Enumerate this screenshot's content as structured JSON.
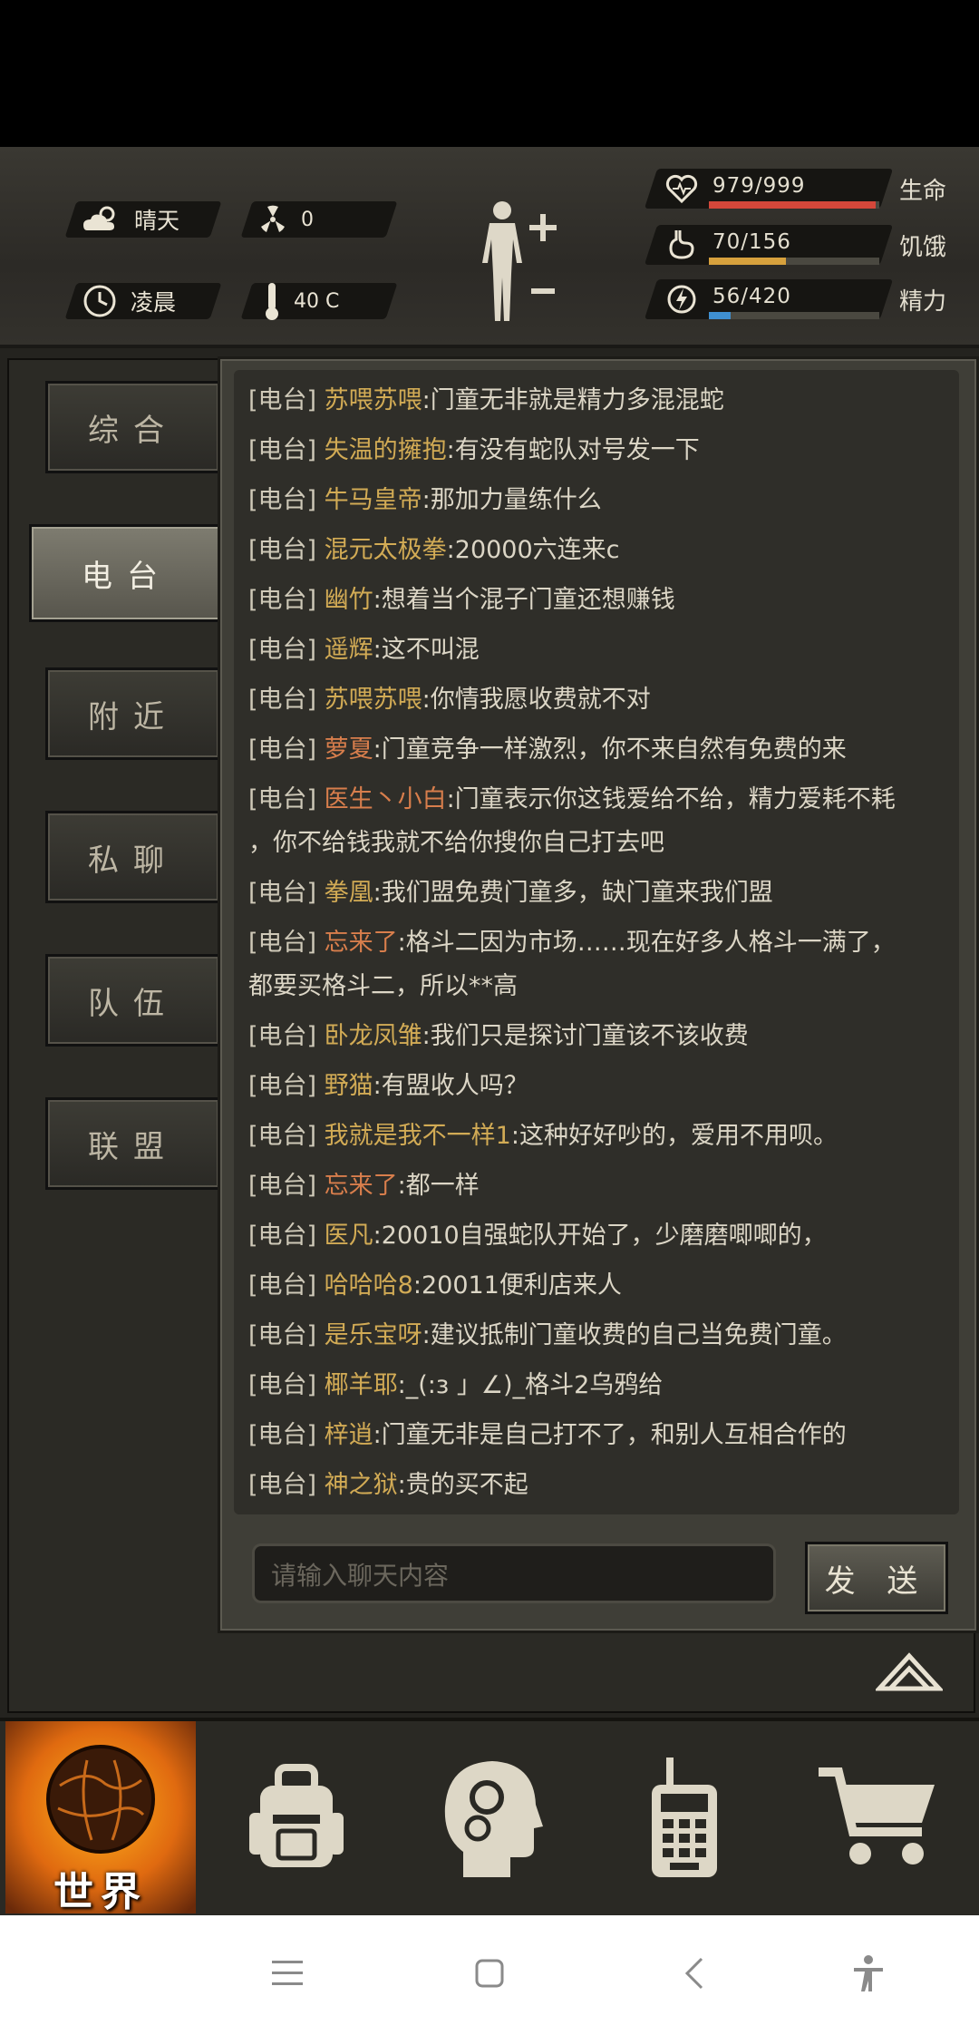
{
  "hud": {
    "weather": "晴天",
    "radiation": "0",
    "time_of_day": "凌晨",
    "temperature": "40 C",
    "stats": [
      {
        "value": "979/999",
        "label": "生命",
        "fraction": 0.98,
        "color": "#d4473a"
      },
      {
        "value": "70/156",
        "label": "饥饿",
        "fraction": 0.45,
        "color": "#d7a13d"
      },
      {
        "value": "56/420",
        "label": "精力",
        "fraction": 0.13,
        "color": "#3f8fd0"
      }
    ]
  },
  "tabs": [
    "综合",
    "电台",
    "附近",
    "私聊",
    "队伍",
    "联盟"
  ],
  "chat": {
    "prefix": "[电台]",
    "messages": [
      {
        "nick": "苏喂苏喂",
        "text": ":门童无非就是精力多混混蛇"
      },
      {
        "nick": "失温的擁抱",
        "text": ":有没有蛇队对号发一下"
      },
      {
        "nick": "牛马皇帝",
        "text": ":那加力量练什么"
      },
      {
        "nick": "混元太极拳",
        "text": ":20000六连来c"
      },
      {
        "nick": "幽竹",
        "text": ":想着当个混子门童还想赚钱"
      },
      {
        "nick": "遥辉",
        "text": ":这不叫混"
      },
      {
        "nick": "苏喂苏喂",
        "text": ":你情我愿收费就不对"
      },
      {
        "nick": "萝夏",
        "text": ":门童竞争一样激烈，你不来自然有免费的来"
      },
      {
        "nick": "医生丶小白",
        "text": ":门童表示你这钱爱给不给，精力爱耗不耗",
        "cont": "，你不给钱我就不给你搜你自己打去吧"
      },
      {
        "nick": "拳凰",
        "text": ":我们盟免费门童多，缺门童来我们盟"
      },
      {
        "nick": "忘来了",
        "text": ":格斗二因为市场……现在好多人格斗一满了，",
        "cont": "都要买格斗二，所以**高"
      },
      {
        "nick": "卧龙凤雏",
        "text": ":我们只是探讨门童该不该收费"
      },
      {
        "nick": "野猫",
        "text": ":有盟收人吗？"
      },
      {
        "nick": "我就是我不一样1",
        "text": ":这种好好吵的，爱用不用呗。"
      },
      {
        "nick": "忘来了",
        "text": ":都一样"
      },
      {
        "nick": "医凡",
        "text": ":20010自强蛇队开始了，少磨磨唧唧的，"
      },
      {
        "nick": "哈哈哈8",
        "text": ":20011便利店来人"
      },
      {
        "nick": "是乐宝呀",
        "text": ":建议抵制门童收费的自己当免费门童。"
      },
      {
        "nick": "椰羊耶",
        "text": ":_(:з 」∠)_格斗2乌鸦给"
      },
      {
        "nick": "梓逍",
        "text": ":门童无非是自己打不了，和别人互相合作的"
      },
      {
        "nick": "神之狱",
        "text": ":贵的买不起"
      }
    ],
    "input_placeholder": "请输入聊天内容",
    "send_label": "发 送"
  },
  "nav": {
    "world_label": "世界"
  }
}
